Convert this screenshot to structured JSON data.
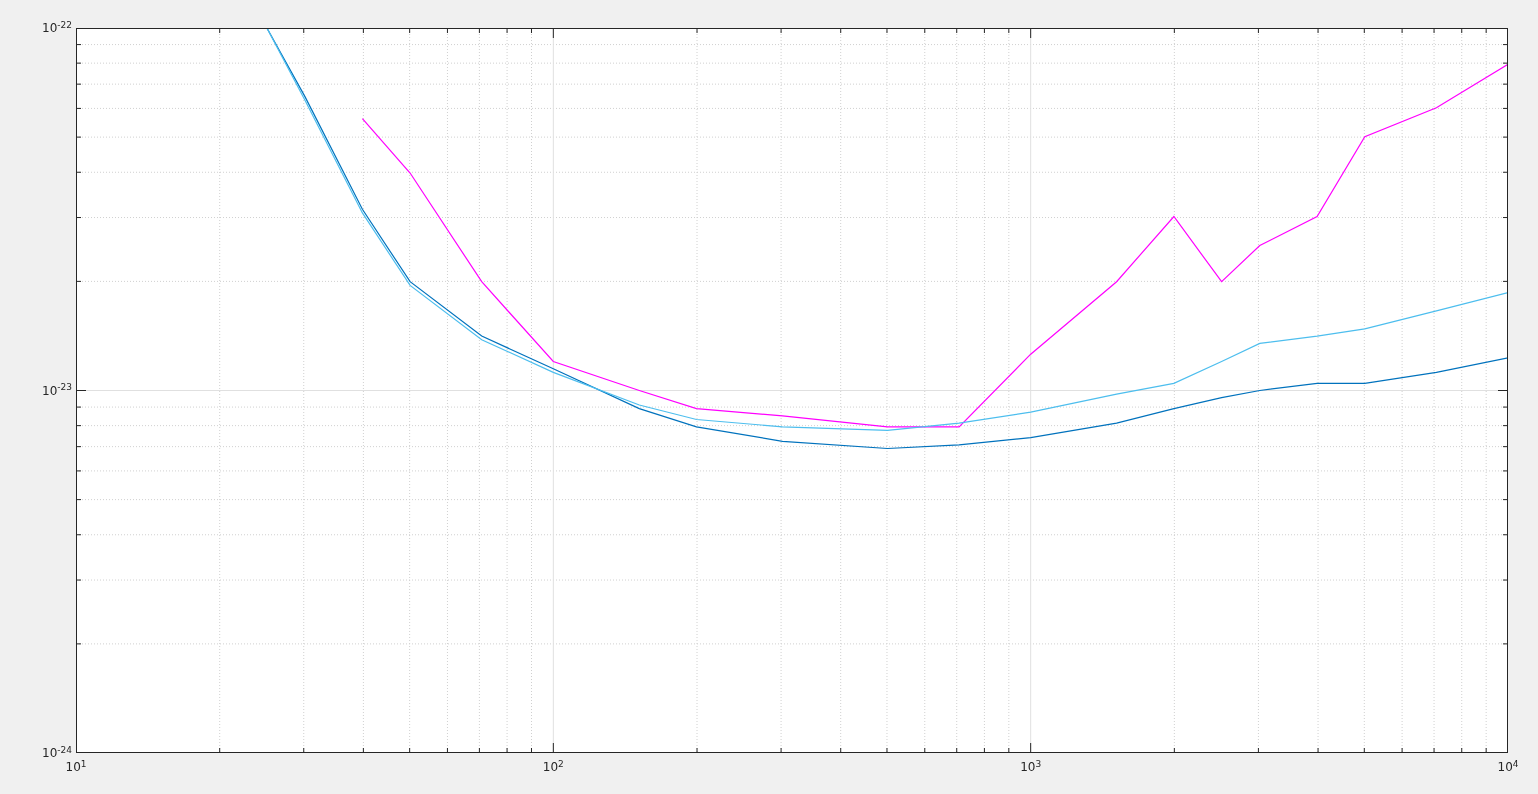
{
  "plot": {
    "x_tick_labels": [
      "10$^{1}$",
      "10$^{2}$",
      "10$^{3}$",
      "10$^{4}$"
    ],
    "y_tick_labels": [
      "10$^{-22}$",
      "10$^{-23}$",
      "10$^{-24}$"
    ]
  }
}
